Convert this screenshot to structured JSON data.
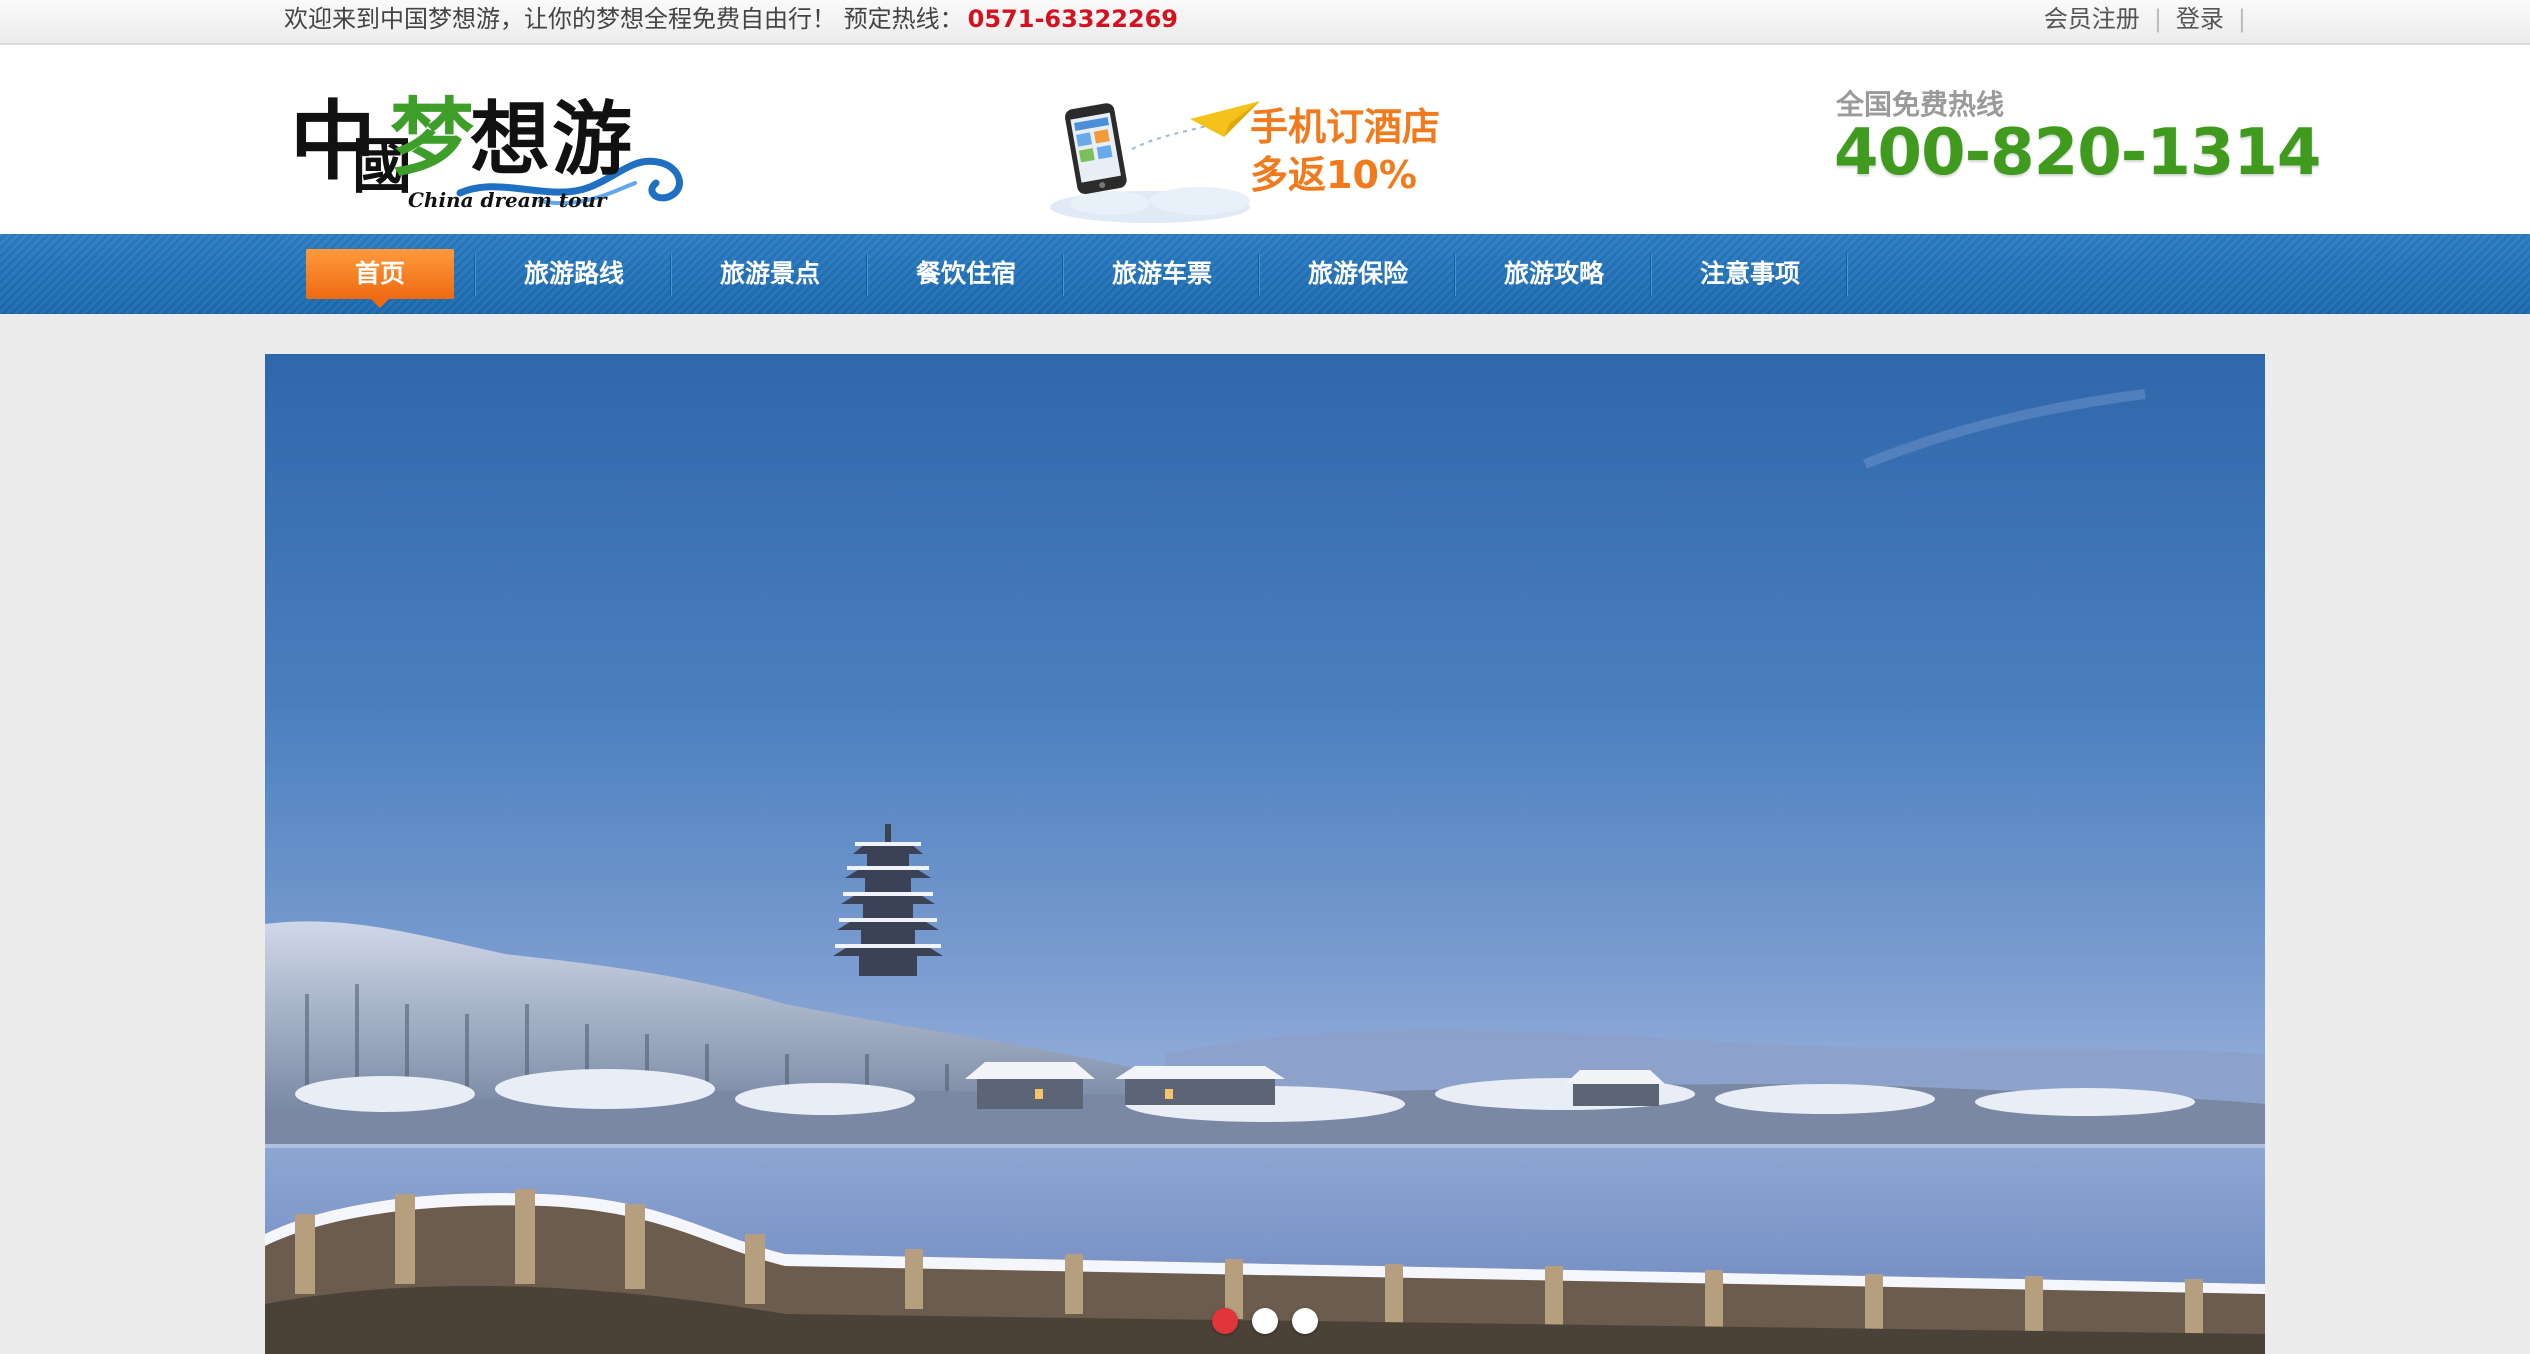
{
  "topbar": {
    "welcome_text": "欢迎来到中国梦想游，让你的梦想全程免费自由行！  预定热线：",
    "hotline_number": "0571-63322269",
    "links": [
      {
        "label": "会员注册"
      },
      {
        "label": "登录"
      }
    ]
  },
  "header": {
    "logo": {
      "cn": "中國梦想游",
      "en": "China dream tour"
    },
    "promo": {
      "line1": "手机订酒店",
      "line2": "多返10%"
    },
    "free_hotline": {
      "label": "全国免费热线",
      "number": "400-820-1314"
    }
  },
  "nav": {
    "items": [
      {
        "label": "首页",
        "active": true
      },
      {
        "label": "旅游路线"
      },
      {
        "label": "旅游景点"
      },
      {
        "label": "餐饮住宿"
      },
      {
        "label": "旅游车票"
      },
      {
        "label": "旅游保险"
      },
      {
        "label": "旅游攻略"
      },
      {
        "label": "注意事项"
      }
    ]
  },
  "banner": {
    "slides": 3,
    "active_slide": 1
  },
  "colors": {
    "hotline_red": "#d4121f",
    "nav_blue": "#1e6db3",
    "active_orange": "#f07a1c",
    "free_hotline_green": "#3f9a1e",
    "dot_active": "#e0353a"
  }
}
